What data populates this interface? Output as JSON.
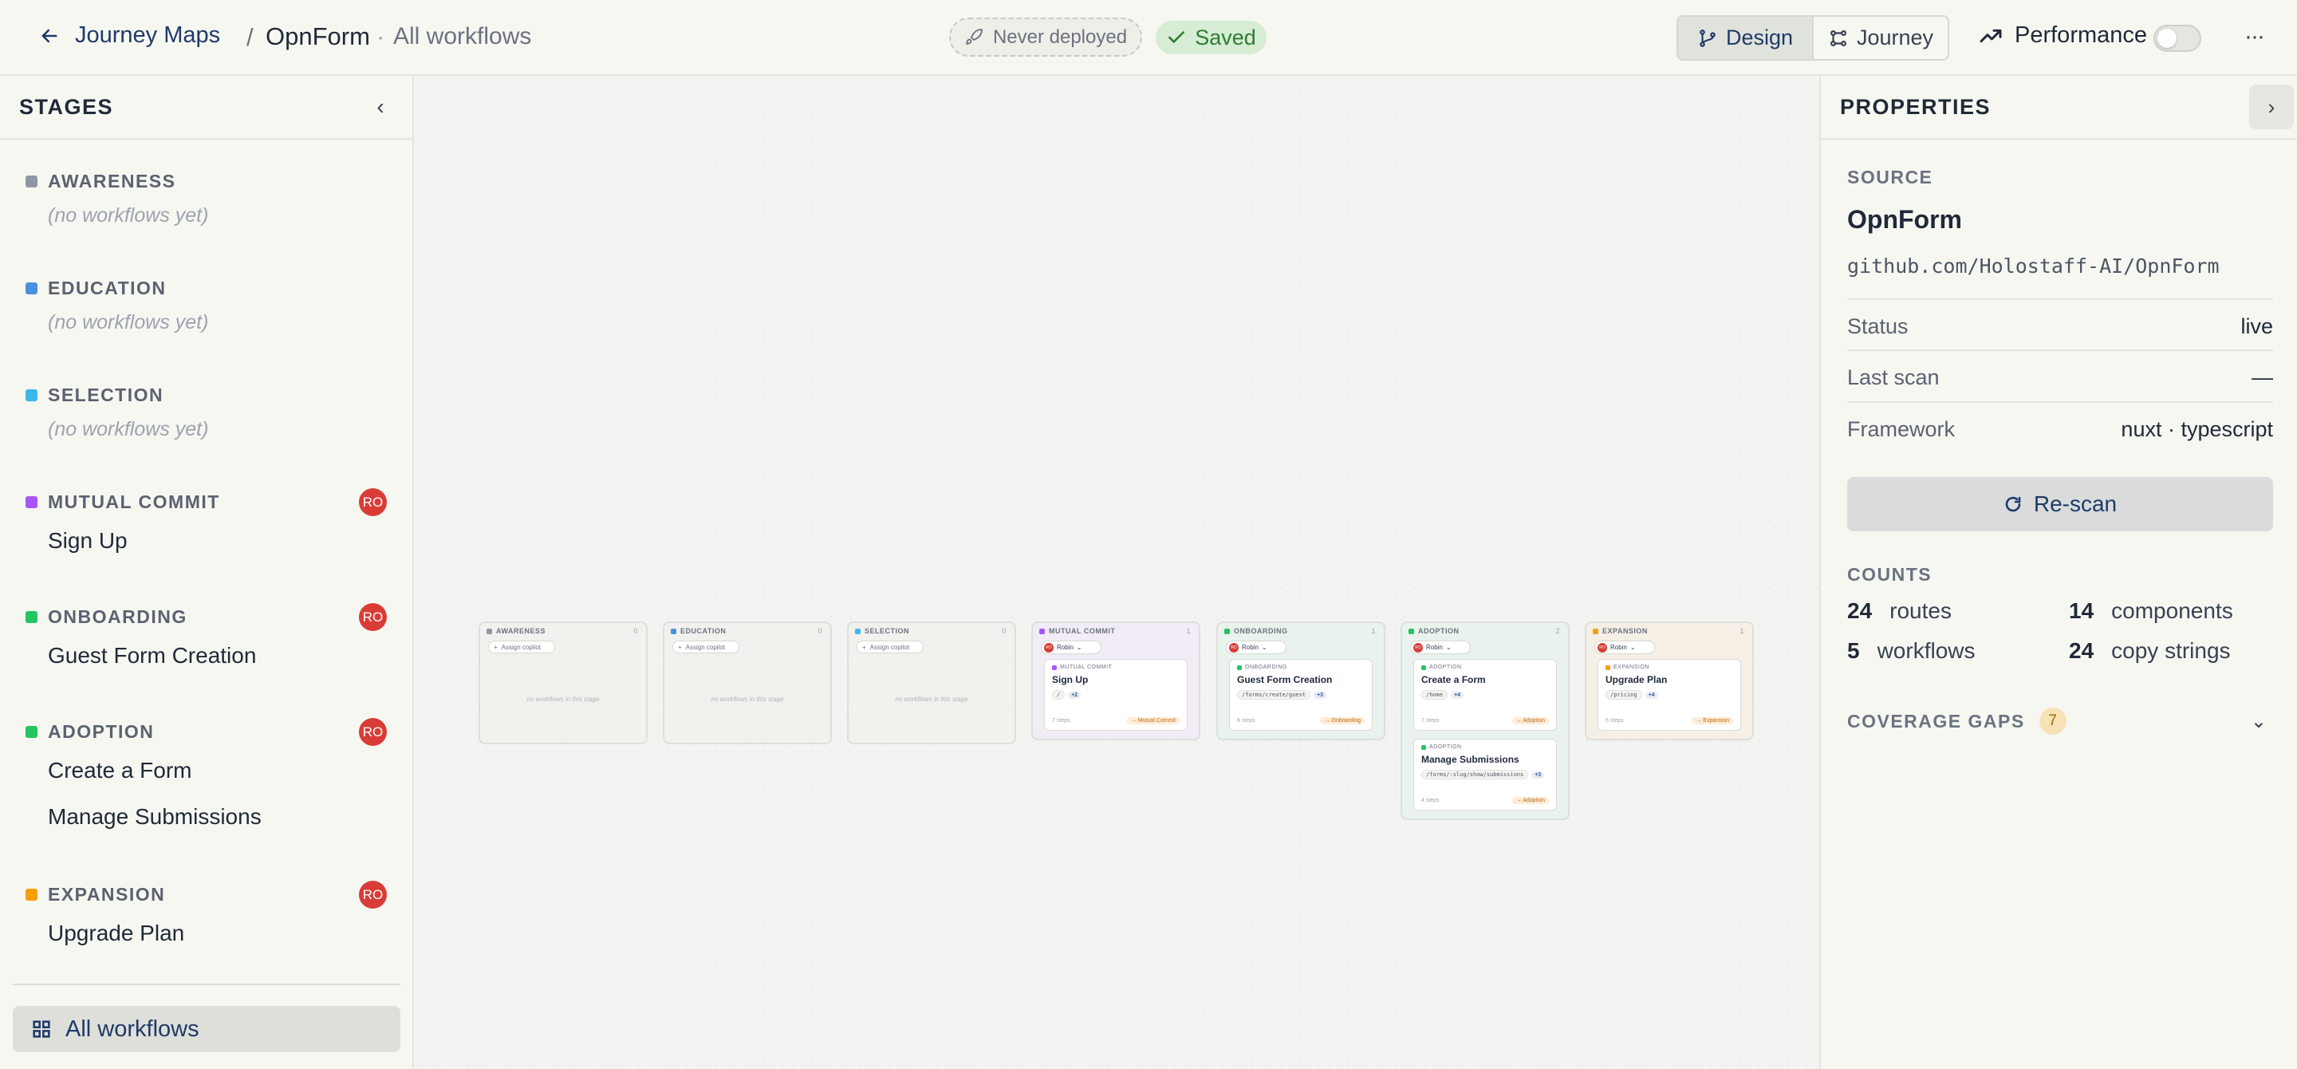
{
  "header": {
    "back_label": "Journey Maps",
    "separator": "/",
    "project": "OpnForm",
    "dot": "·",
    "view": "All workflows",
    "deploy_status": "Never deployed",
    "save_status": "Saved",
    "modes": [
      {
        "label": "Design",
        "active": true
      },
      {
        "label": "Journey",
        "active": false
      }
    ],
    "performance_label": "Performance",
    "performance_on": false,
    "more_glyph": "···"
  },
  "sidebar": {
    "title": "STAGES",
    "stages": [
      {
        "name": "AWARENESS",
        "color": "#8f96a3",
        "owner": "",
        "empty_note": "(no workflows yet)",
        "workflows": []
      },
      {
        "name": "EDUCATION",
        "color": "#4a90e2",
        "owner": "",
        "empty_note": "(no workflows yet)",
        "workflows": []
      },
      {
        "name": "SELECTION",
        "color": "#3fb6e8",
        "owner": "",
        "empty_note": "(no workflows yet)",
        "workflows": []
      },
      {
        "name": "MUTUAL COMMIT",
        "color": "#a855f7",
        "owner": "RO",
        "empty_note": "",
        "workflows": [
          "Sign Up"
        ]
      },
      {
        "name": "ONBOARDING",
        "color": "#22c55e",
        "owner": "RO",
        "empty_note": "",
        "workflows": [
          "Guest Form Creation"
        ]
      },
      {
        "name": "ADOPTION",
        "color": "#22c55e",
        "owner": "RO",
        "empty_note": "",
        "workflows": [
          "Create a Form",
          "Manage Submissions"
        ]
      },
      {
        "name": "EXPANSION",
        "color": "#f59e0b",
        "owner": "RO",
        "empty_note": "",
        "workflows": [
          "Upgrade Plan"
        ]
      }
    ],
    "all_workflows_label": "All workflows"
  },
  "canvas": {
    "assign_label": "Assign copilot",
    "owner_name": "Robin",
    "owner_initials": "RO",
    "empty_label": "no workflows in this stage",
    "columns": [
      {
        "name": "AWARENESS",
        "color": "#8f96a3",
        "count": "0",
        "bg": "rgba(240,240,236,.7)",
        "cards": []
      },
      {
        "name": "EDUCATION",
        "color": "#4a90e2",
        "count": "0",
        "bg": "rgba(240,240,236,.7)",
        "cards": []
      },
      {
        "name": "SELECTION",
        "color": "#3fb6e8",
        "count": "0",
        "bg": "rgba(240,240,236,.7)",
        "cards": []
      },
      {
        "name": "MUTUAL COMMIT",
        "color": "#a855f7",
        "count": "1",
        "bg": "#f1ecf6",
        "cards": [
          {
            "stage": "MUTUAL COMMIT",
            "title": "Sign Up",
            "route": "/",
            "extra": "+2",
            "steps": "7 steps",
            "tag": "→ Mutual Commit"
          }
        ]
      },
      {
        "name": "ONBOARDING",
        "color": "#22c55e",
        "count": "1",
        "bg": "#e9f2ec",
        "cards": [
          {
            "stage": "ONBOARDING",
            "title": "Guest Form Creation",
            "route": "/forms/create/guest",
            "extra": "+3",
            "steps": "6 steps",
            "tag": "→ Onboarding"
          }
        ]
      },
      {
        "name": "ADOPTION",
        "color": "#22c55e",
        "count": "2",
        "bg": "#e9f2ec",
        "cards": [
          {
            "stage": "ADOPTION",
            "title": "Create a Form",
            "route": "/home",
            "extra": "+4",
            "steps": "7 steps",
            "tag": "→ Adoption"
          },
          {
            "stage": "ADOPTION",
            "title": "Manage Submissions",
            "route": "/forms/:slug/show/submissions",
            "extra": "+3",
            "steps": "4 steps",
            "tag": "→ Adoption"
          }
        ]
      },
      {
        "name": "EXPANSION",
        "color": "#f59e0b",
        "count": "1",
        "bg": "#f5efe6",
        "cards": [
          {
            "stage": "EXPANSION",
            "title": "Upgrade Plan",
            "route": "/pricing",
            "extra": "+4",
            "steps": "6 steps",
            "tag": "→ Expansion"
          }
        ]
      }
    ]
  },
  "properties": {
    "title": "PROPERTIES",
    "source_section": "SOURCE",
    "source_name": "OpnForm",
    "source_repo": "github.com/Holostaff-AI/OpnForm",
    "rows": [
      {
        "key": "Status",
        "value": "live"
      },
      {
        "key": "Last scan",
        "value": "—"
      },
      {
        "key": "Framework",
        "value": "nuxt · typescript"
      }
    ],
    "rescan_label": "Re-scan",
    "counts_section": "COUNTS",
    "counts": [
      {
        "n": "24",
        "label": "routes"
      },
      {
        "n": "14",
        "label": "components"
      },
      {
        "n": "5",
        "label": "workflows"
      },
      {
        "n": "24",
        "label": "copy strings"
      }
    ],
    "gaps_label": "COVERAGE GAPS",
    "gaps_count": "7"
  }
}
